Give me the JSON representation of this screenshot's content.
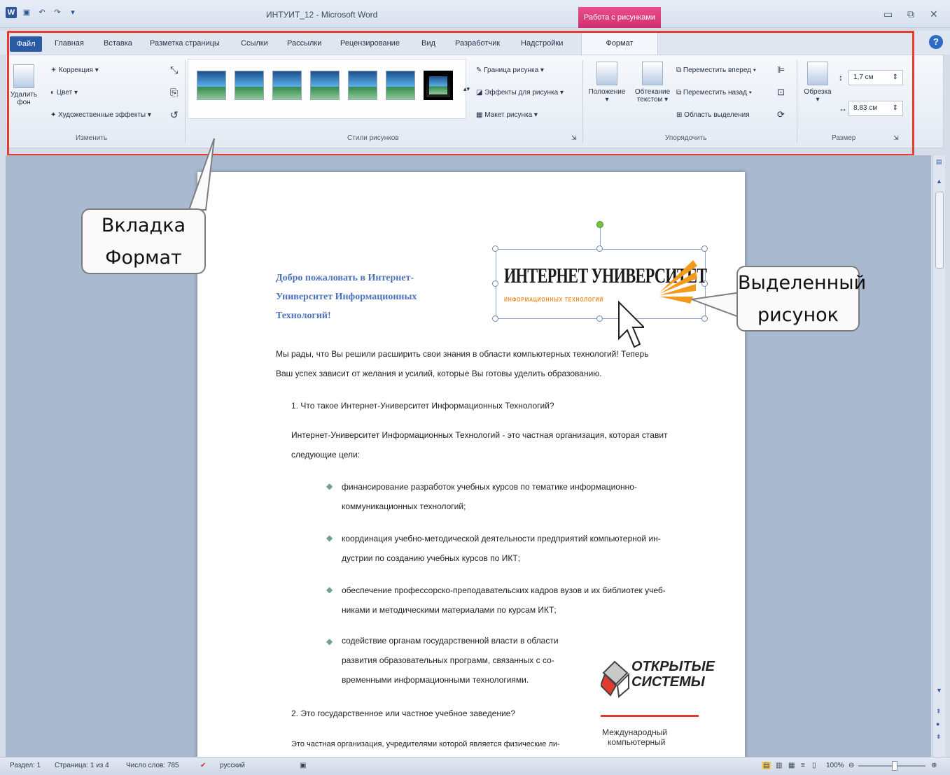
{
  "window": {
    "title": "ИНТУИТ_12 - Microsoft Word",
    "context_tab_group": "Работа с рисунками"
  },
  "ribbon": {
    "file_tab": "Файл",
    "tabs": [
      "Главная",
      "Вставка",
      "Разметка страницы",
      "Ссылки",
      "Рассылки",
      "Рецензирование",
      "Вид",
      "Разработчик",
      "Надстройки"
    ],
    "active_tab": "Формат",
    "adjust_group": {
      "remove_bg_line1": "Удалить",
      "remove_bg_line2": "фон",
      "corrections": "Коррекция ▾",
      "color": "Цвет ▾",
      "artistic_effects": "Художественные эффекты ▾",
      "label": "Изменить"
    },
    "styles_group": {
      "picture_border": "Граница рисунка ▾",
      "picture_effects": "Эффекты для рисунка ▾",
      "picture_layout": "Макет рисунка ▾",
      "label": "Стили рисунков"
    },
    "arrange_group": {
      "position": "Положение",
      "wrap_text_line1": "Обтекание",
      "wrap_text_line2": "текстом ▾",
      "bring_forward": "Переместить вперед ▾",
      "send_backward": "Переместить назад ▾",
      "selection_pane": "Область выделения",
      "label": "Упорядочить"
    },
    "size_group": {
      "crop": "Обрезка",
      "height": "1,7 см",
      "width": "8,83 см",
      "label": "Размер"
    }
  },
  "callouts": {
    "format_tab_line1": "Вкладка",
    "format_tab_line2": "Формат",
    "selected_picture_line1": "Выделенный",
    "selected_picture_line2": "рисунок"
  },
  "document": {
    "heading_lines": [
      "Добро пожаловать в Интернет-",
      "Университет Информационных",
      "Технологий!"
    ],
    "logo_main": "ИНТЕРНЕТ УНИВЕРСИТЕТ",
    "logo_sub": "ИНФОРМАЦИОННЫХ ТЕХНОЛОГИЙ",
    "intro_lines": [
      "Мы рады, что Вы решили расширить свои знания в области компьютерных технологий! Теперь",
      "Ваш успех зависит от желания и усилий, которые Вы готовы уделить образованию."
    ],
    "q1": "1.   Что такое Интернет-Университет Информационных Технологий?",
    "answer1_lines": [
      "Интернет-Университет Информационных Технологий - это частная организация, которая ставит",
      "следующие цели:"
    ],
    "bullets": [
      [
        "финансирование разработок учебных курсов по тематике информационно-",
        "коммуникационных технологий;"
      ],
      [
        "координация учебно-методической деятельности предприятий компьютерной ин-",
        "дустрии по созданию учебных курсов по ИКТ;"
      ],
      [
        "обеспечение профессорско-преподавательских кадров вузов и их библиотек учеб-",
        "никами и методическими материалами по курсам ИКТ;"
      ],
      [
        "содействие органам государственной власти в области",
        "развития образовательных программ, связанных с со-",
        "временными информационными технологиями."
      ]
    ],
    "q2": "2.   Это государственное или частное учебное заведение?",
    "answer2_line": "Это частная организация, учредителями которой является физические ли-",
    "os_logo_line1": "ОТКРЫТЫЕ",
    "os_logo_line2": "СИСТЕМЫ",
    "os_caption_line1": "Международный",
    "os_caption_line2": "компьютерный"
  },
  "statusbar": {
    "section": "Раздел: 1",
    "page": "Страница: 1 из 4",
    "words": "Число слов: 785",
    "language": "русский",
    "zoom": "100%"
  }
}
